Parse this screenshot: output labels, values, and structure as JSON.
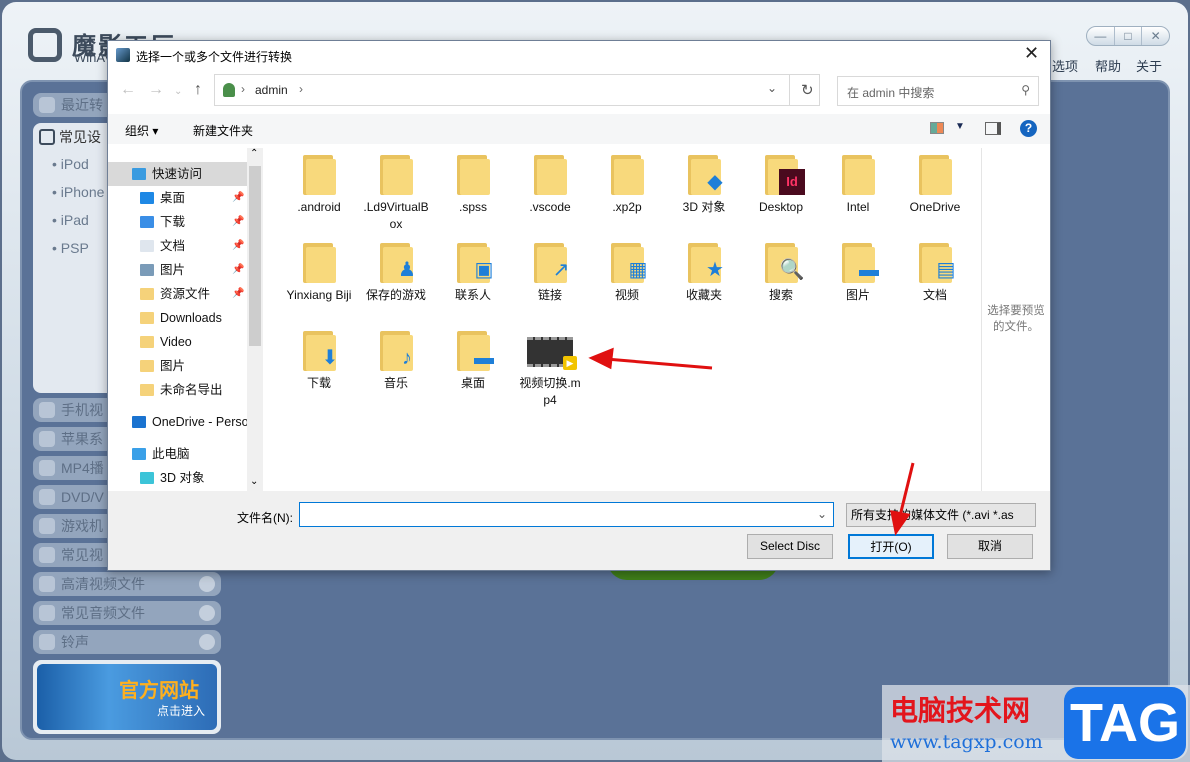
{
  "app": {
    "logo_text": "魔影工厂",
    "logo_sub": "WinAV",
    "menu": [
      "选项",
      "帮助",
      "关于"
    ],
    "window_buttons": [
      "—",
      "□",
      "✕"
    ],
    "sidebar_top": "最近转",
    "devices_header": "常见设",
    "devices": [
      "iPod",
      "iPhone",
      "iPad",
      "PSP"
    ],
    "sidebar_items": [
      "手机视",
      "苹果系",
      "MP4播",
      "DVD/V",
      "游戏机",
      "常见视",
      "高清视频文件",
      "常见音频文件",
      "铃声"
    ],
    "banner_title": "官方网站",
    "banner_sub": "点击进入"
  },
  "dialog": {
    "title": "选择一个或多个文件进行转换",
    "breadcrumb": "admin",
    "search_placeholder": "在 admin 中搜索",
    "toolbar": {
      "organize": "组织 ▾",
      "new_folder": "新建文件夹"
    },
    "nav": [
      {
        "label": "快速访问",
        "icon": "star-icon",
        "color": "#3a9be0",
        "indent": 0,
        "selected": true
      },
      {
        "label": "桌面",
        "icon": "desktop-icon",
        "color": "#1e88e5",
        "indent": 1,
        "pin": true
      },
      {
        "label": "下载",
        "icon": "download-icon",
        "color": "#3a8ee6",
        "indent": 1,
        "pin": true
      },
      {
        "label": "文档",
        "icon": "document-icon",
        "color": "#dfe6ee",
        "indent": 1,
        "pin": true
      },
      {
        "label": "图片",
        "icon": "pictures-icon",
        "color": "#7a9bb8",
        "indent": 1,
        "pin": true
      },
      {
        "label": "资源文件",
        "icon": "folder-icon",
        "color": "#f5d27a",
        "indent": 1,
        "pin": true
      },
      {
        "label": "Downloads",
        "icon": "folder-icon",
        "color": "#f5d27a",
        "indent": 1
      },
      {
        "label": "Video",
        "icon": "folder-icon",
        "color": "#f5d27a",
        "indent": 1
      },
      {
        "label": "图片",
        "icon": "folder-icon",
        "color": "#f5d27a",
        "indent": 1
      },
      {
        "label": "未命名导出",
        "icon": "folder-icon",
        "color": "#f5d27a",
        "indent": 1
      },
      {
        "label": "OneDrive - Perso",
        "icon": "onedrive-icon",
        "color": "#1a73d0",
        "indent": 0,
        "gap": 8
      },
      {
        "label": "此电脑",
        "icon": "computer-icon",
        "color": "#3aa0e8",
        "indent": 0,
        "gap": 8
      },
      {
        "label": "3D 对象",
        "icon": "cube-icon",
        "color": "#3cc4d8",
        "indent": 1
      }
    ],
    "files": [
      {
        "name": ".android",
        "icon": "folder-icon",
        "overlay": ""
      },
      {
        "name": ".Ld9VirtualBox",
        "icon": "folder-icon",
        "overlay": ""
      },
      {
        "name": ".spss",
        "icon": "folder-icon",
        "overlay": ""
      },
      {
        "name": ".vscode",
        "icon": "folder-icon",
        "overlay": ""
      },
      {
        "name": ".xp2p",
        "icon": "folder-icon",
        "overlay": ""
      },
      {
        "name": "3D 对象",
        "icon": "3d-objects-folder-icon",
        "overlay": "◆"
      },
      {
        "name": "Desktop",
        "icon": "indesign-folder-icon",
        "overlay": "Id"
      },
      {
        "name": "Intel",
        "icon": "folder-icon",
        "overlay": ""
      },
      {
        "name": "OneDrive",
        "icon": "folder-icon",
        "overlay": ""
      },
      {
        "name": "Yinxiang Biji",
        "icon": "folder-icon",
        "overlay": ""
      },
      {
        "name": "保存的游戏",
        "icon": "saved-games-folder-icon",
        "overlay": "♟"
      },
      {
        "name": "联系人",
        "icon": "contacts-folder-icon",
        "overlay": "▣"
      },
      {
        "name": "链接",
        "icon": "links-folder-icon",
        "overlay": "↗"
      },
      {
        "name": "视频",
        "icon": "videos-folder-icon",
        "overlay": "▦"
      },
      {
        "name": "收藏夹",
        "icon": "favorites-folder-icon",
        "overlay": "★"
      },
      {
        "name": "搜索",
        "icon": "search-folder-icon",
        "overlay": "🔍"
      },
      {
        "name": "图片",
        "icon": "pictures-folder-icon",
        "overlay": "▬"
      },
      {
        "name": "文档",
        "icon": "documents-folder-icon",
        "overlay": "▤"
      },
      {
        "name": "下载",
        "icon": "downloads-folder-icon",
        "overlay": "⬇"
      },
      {
        "name": "音乐",
        "icon": "music-folder-icon",
        "overlay": "♪"
      },
      {
        "name": "桌面",
        "icon": "desktop-folder-icon",
        "overlay": "▬"
      },
      {
        "name": "视频切换.mp4",
        "icon": "video-file-icon",
        "overlay": ""
      }
    ],
    "preview_text": "选择要预览的文件。",
    "filename_label": "文件名(N):",
    "filename_value": "",
    "filter": "所有支持的媒体文件 (*.avi *.as",
    "buttons": {
      "select_disc": "Select Disc",
      "open": "打开(O)",
      "cancel": "取消"
    }
  },
  "watermark": {
    "site": "电脑技术网",
    "url": "www.tagxp.com",
    "tag": "TAG"
  }
}
